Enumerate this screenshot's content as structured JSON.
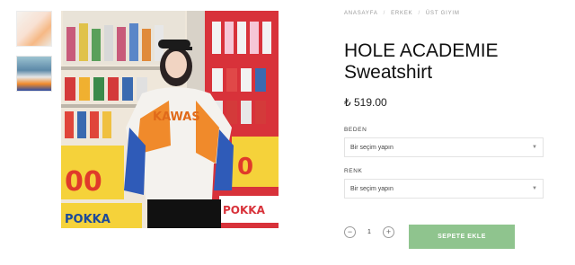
{
  "breadcrumb": [
    "Anasayfa",
    "Erkek",
    "Üst Giyim"
  ],
  "product": {
    "title_line1": "HOLE ACADEMIE",
    "title_line2": "Sweatshirt",
    "price": "₺ 519.00"
  },
  "options": {
    "size_label": "BEDEN",
    "size_value": "Bir seçim yapın",
    "color_label": "RENK",
    "color_value": "Bir seçim yapın"
  },
  "quantity": {
    "minus": "−",
    "value": "1",
    "plus": "+"
  },
  "add_to_cart_label": "SEPETE EKLE",
  "colors": {
    "accent_green": "#8fc48e"
  },
  "icons": {
    "select_arrow": "chevron-down-icon"
  }
}
